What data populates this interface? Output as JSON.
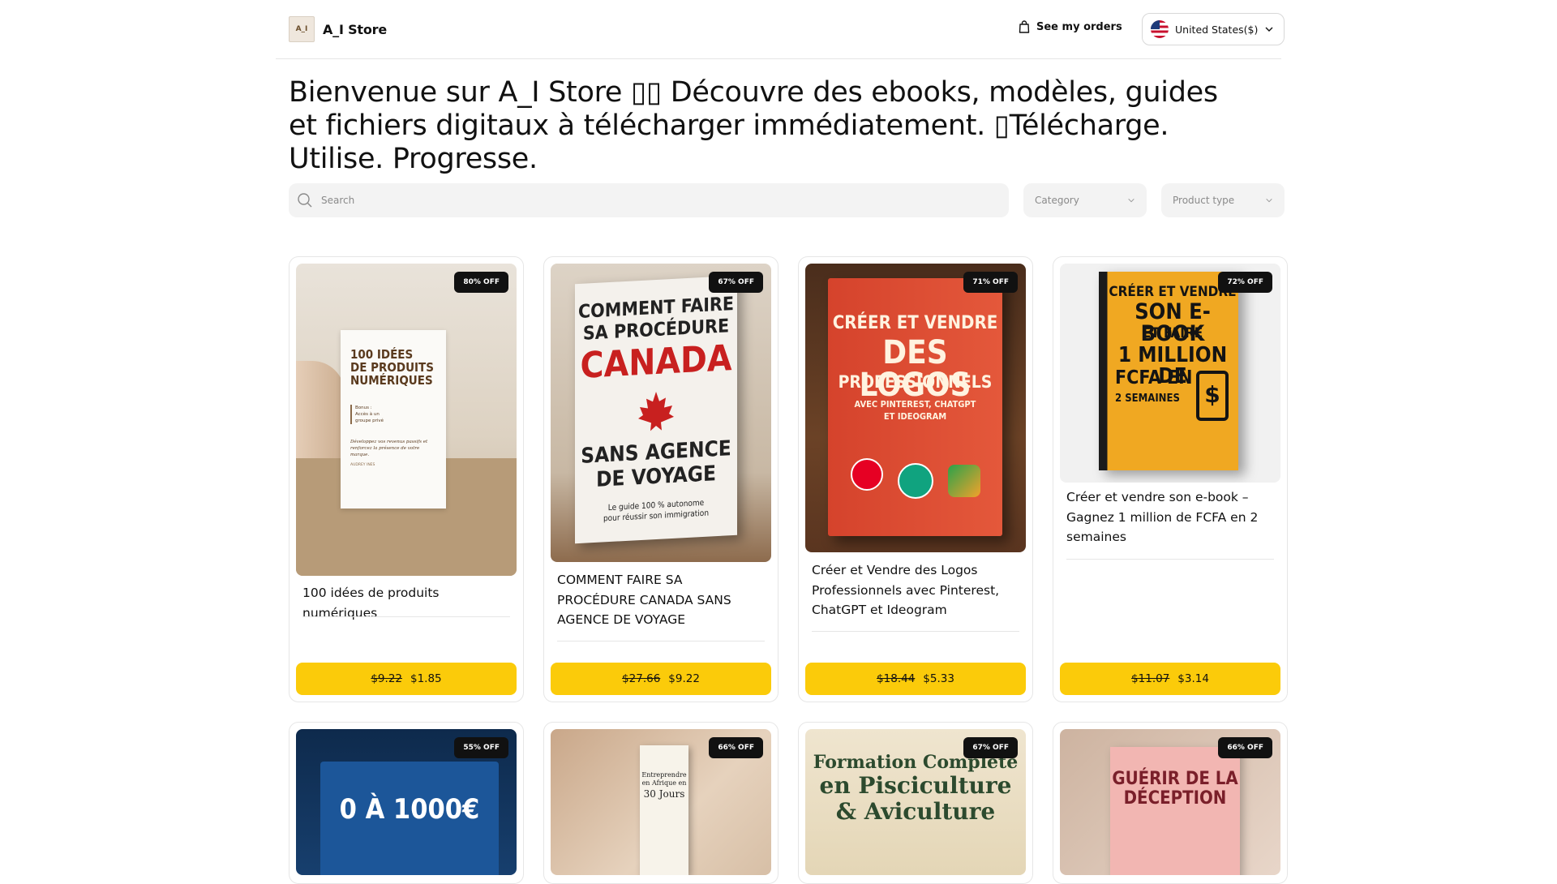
{
  "header": {
    "brand_name": "A_I Store",
    "logo_text": "A_I",
    "orders_label": "See my orders",
    "locale_label": "United States($)"
  },
  "hero": {
    "text": "Bienvenue sur A_I Store ▯▯ Découvre des ebooks, modèles, guides et fichiers digitaux à télécharger immédiatement. ▯Télécharge. Utilise. Progresse."
  },
  "filters": {
    "search_placeholder": "Search",
    "category_label": "Category",
    "product_type_label": "Product type"
  },
  "products": [
    {
      "badge": "80% OFF",
      "title": "100 idées de produits numériques",
      "old_price": "$9.22",
      "price": "$1.85",
      "cover_lines": [
        "100 IDÉES",
        "DE PRODUITS",
        "NUMÉRIQUES"
      ],
      "cover_small": [
        "Bonus :",
        "Accès à un",
        "groupe privé",
        "Développez vos revenus passifs et",
        "renforcez la présence de votre",
        "marque.",
        "AUDREY INES"
      ]
    },
    {
      "badge": "67% OFF",
      "title": "COMMENT FAIRE SA PROCÉDURE CANADA SANS AGENCE DE VOYAGE",
      "old_price": "$27.66",
      "price": "$9.22",
      "cover_lines": [
        "COMMENT FAIRE",
        "SA PROCÉDURE",
        "CANADA",
        "SANS AGENCE",
        "DE VOYAGE",
        "Le guide 100 % autonome",
        "pour réussir son immigration"
      ]
    },
    {
      "badge": "71% OFF",
      "title": "Créer et Vendre des Logos Professionnels avec Pinterest, ChatGPT et Ideogram",
      "old_price": "$18.44",
      "price": "$5.33",
      "cover_lines": [
        "CRÉER ET VENDRE",
        "DES LOGOS",
        "PROFESSIONNELS",
        "AVEC PINTEREST, CHATGPT",
        "ET IDEOGRAM"
      ]
    },
    {
      "badge": "72% OFF",
      "title": "Créer et vendre son e-book – Gagnez 1 million de FCFA en 2 semaines",
      "old_price": "$11.07",
      "price": "$3.14",
      "cover_lines": [
        "CRÉER ET VENDRE",
        "SON E-BOOK",
        "ET FAIRE",
        "1 MILLION DE",
        "FCFA EN",
        "2 SEMAINES"
      ]
    },
    {
      "badge": "55% OFF",
      "cover_lines": [
        "0 À 1000€"
      ]
    },
    {
      "badge": "66% OFF",
      "cover_lines": [
        "Entreprendre",
        "en Afrique en",
        "30 Jours"
      ]
    },
    {
      "badge": "67% OFF",
      "cover_lines": [
        "Formation Complète",
        "en Pisciculture",
        "& Aviculture"
      ]
    },
    {
      "badge": "66% OFF",
      "cover_lines": [
        "GUÉRIR DE LA",
        "DÉCEPTION"
      ]
    }
  ],
  "colors": {
    "buy_button": "#fbcb0a",
    "badge": "#111111"
  }
}
